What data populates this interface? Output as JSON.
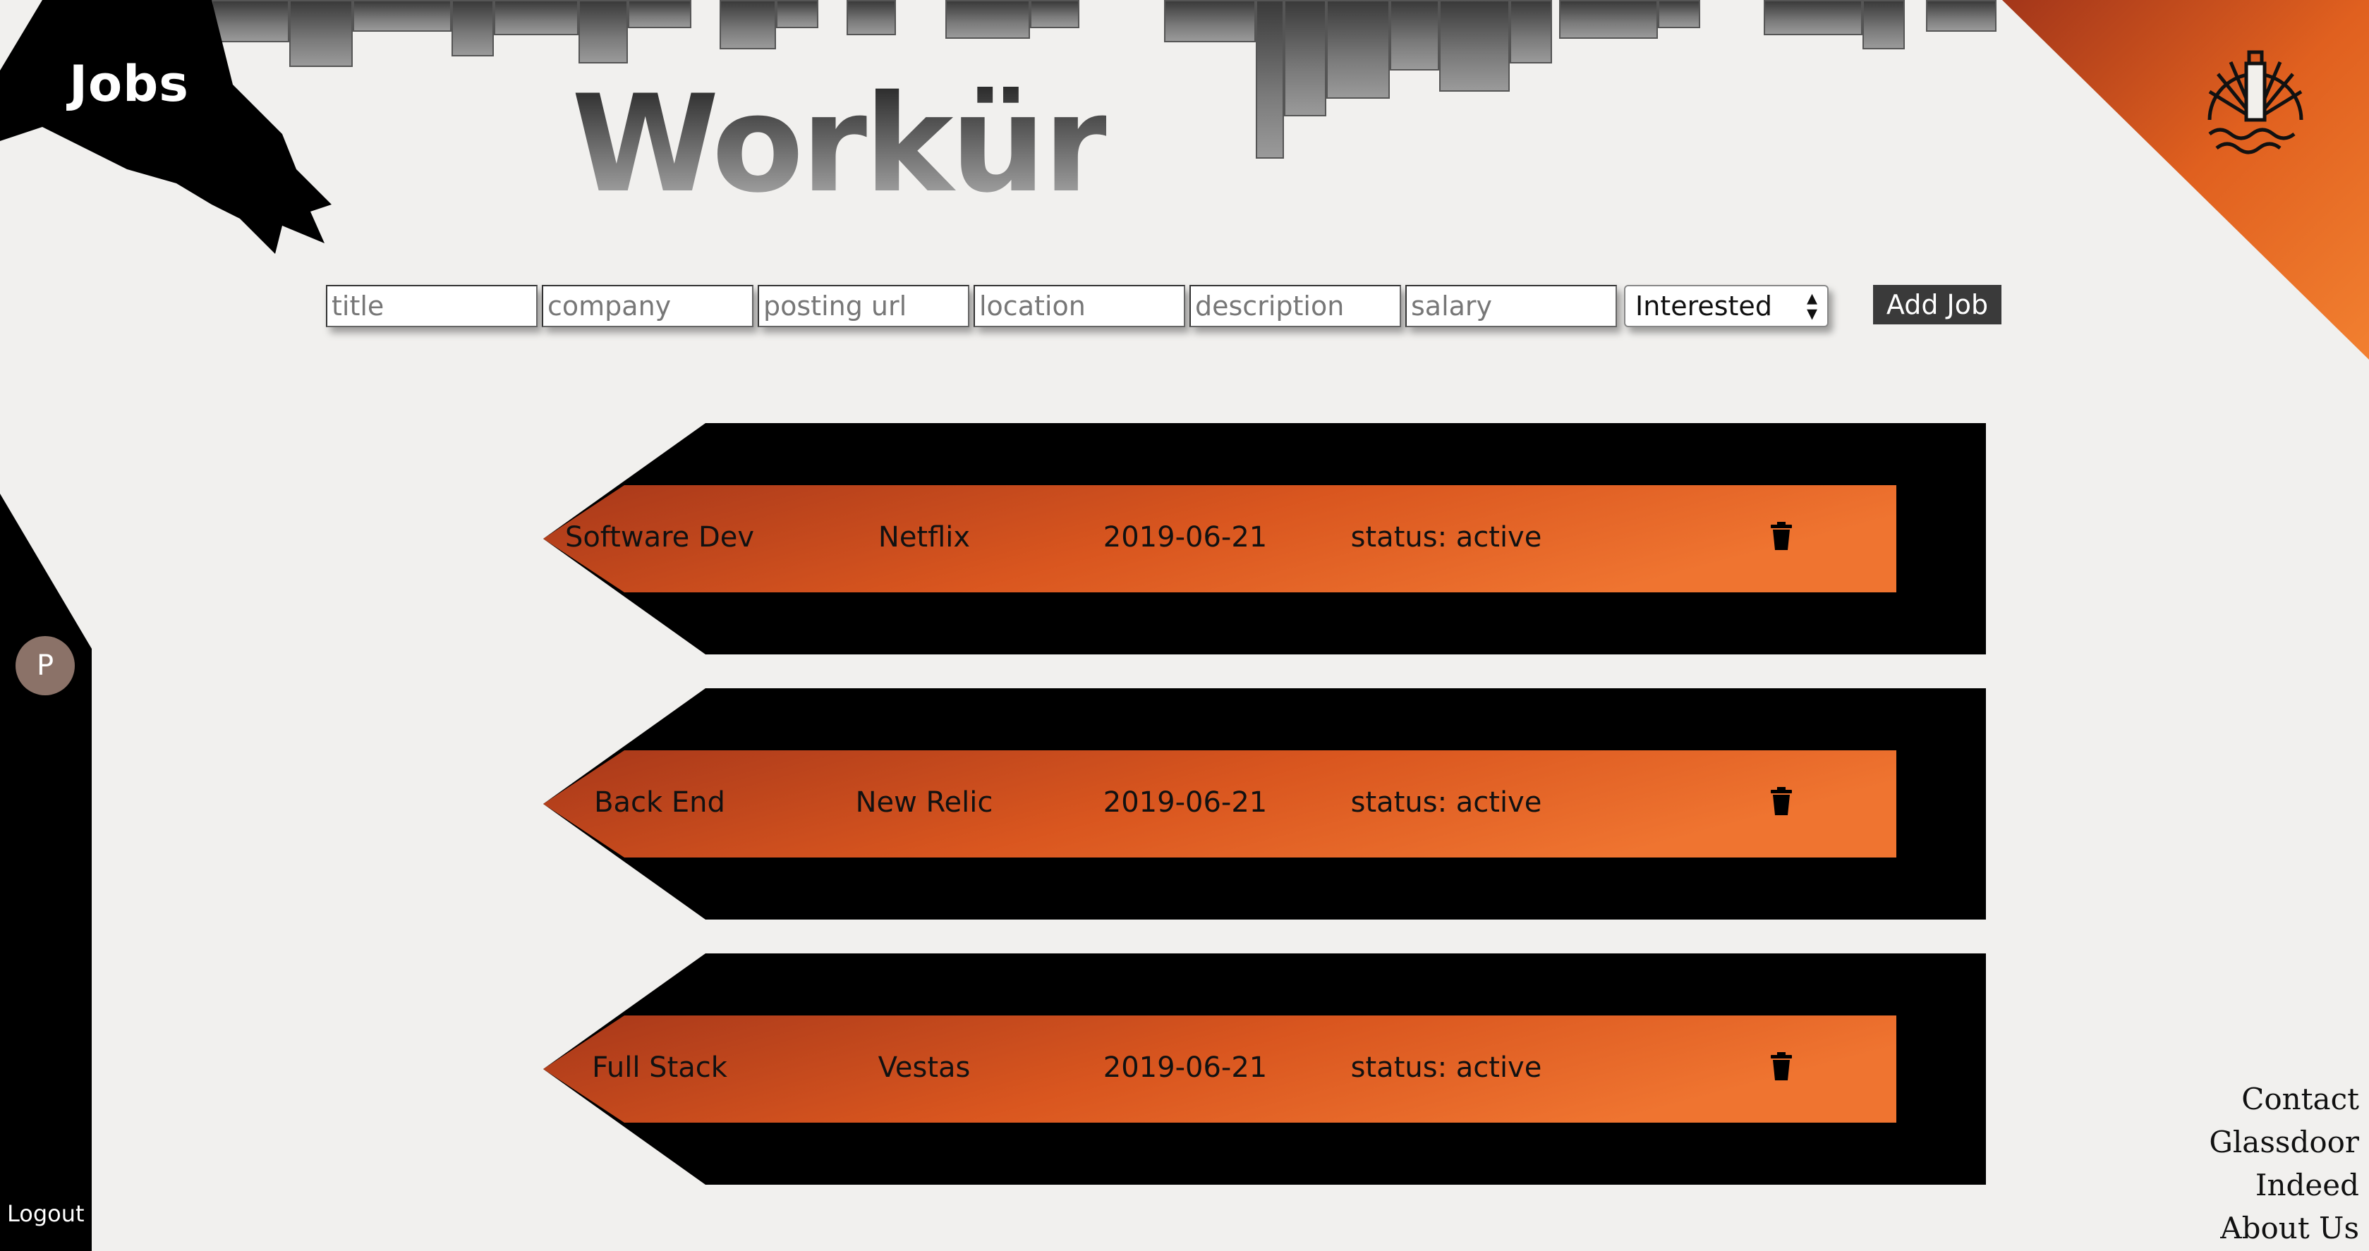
{
  "header": {
    "section_title": "Jobs",
    "brand": "Workür"
  },
  "form": {
    "placeholders": {
      "title": "title",
      "company": "company",
      "posting_url": "posting url",
      "location": "location",
      "description": "description",
      "salary": "salary"
    },
    "status_select": {
      "selected": "Interested"
    },
    "add_button": "Add Job"
  },
  "sidebar": {
    "avatar_initial": "P",
    "logout": "Logout"
  },
  "jobs": [
    {
      "title": "Software Dev",
      "company": "Netflix",
      "date": "2019-06-21",
      "status": "status: active",
      "delete_icon": "trash-icon"
    },
    {
      "title": "Back End",
      "company": "New Relic",
      "date": "2019-06-21",
      "status": "status: active",
      "delete_icon": "trash-icon"
    },
    {
      "title": "Full Stack",
      "company": "Vestas",
      "date": "2019-06-21",
      "status": "status: active",
      "delete_icon": "trash-icon"
    }
  ],
  "footer": {
    "links": [
      "Contact",
      "Glassdoor",
      "Indeed",
      "About Us"
    ]
  },
  "colors": {
    "accent_orange": "#e8672a",
    "accent_dark_orange": "#a63a1a",
    "card_black": "#000000",
    "background": "#f1f0ee"
  }
}
